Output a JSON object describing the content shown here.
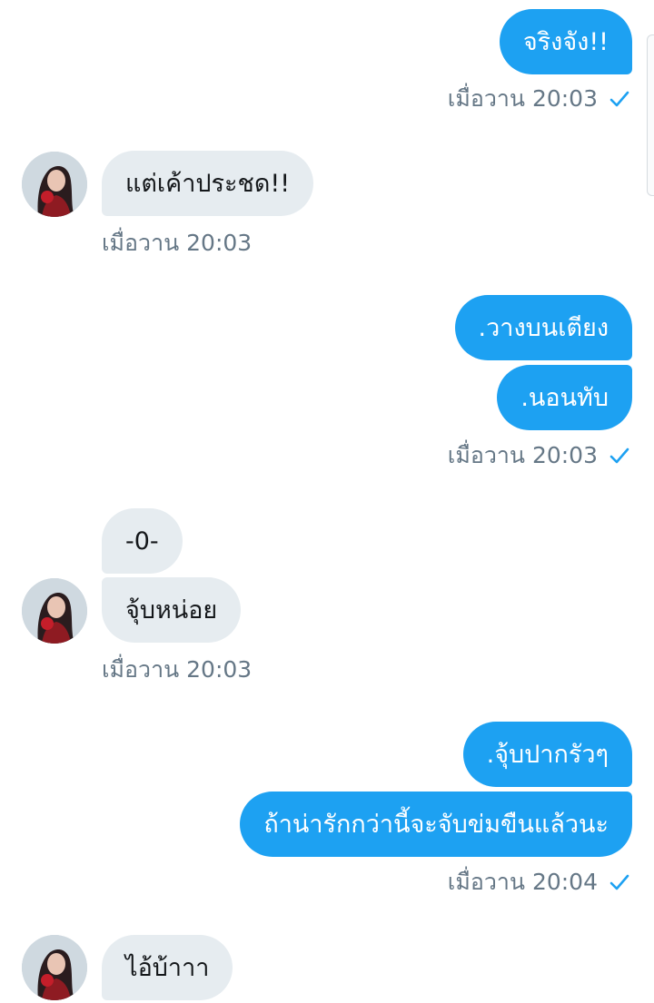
{
  "accent_color": "#1da1f2",
  "conversation": {
    "msg1": {
      "text": "จริงจัง!!",
      "time": "เมื่อวาน 20:03",
      "status_icon": "check-icon"
    },
    "msg2": {
      "text": "แต่เค้าประชด!!",
      "time": "เมื่อวาน 20:03"
    },
    "msg3": {
      "text": ".วางบนเตียง"
    },
    "msg4": {
      "text": ".นอนทับ",
      "time": "เมื่อวาน 20:03",
      "status_icon": "check-icon"
    },
    "msg5": {
      "text": "-0-"
    },
    "msg6": {
      "text": "จุ้บหน่อย",
      "time": "เมื่อวาน 20:03"
    },
    "msg7": {
      "text": ".จุ้บปากรัวๆ"
    },
    "msg8": {
      "text": "ถ้าน่ารักกว่านี้จะจับข่มขืนแล้วนะ",
      "time": "เมื่อวาน 20:04",
      "status_icon": "check-icon"
    },
    "msg9": {
      "text": "ไอ้บ้าาา"
    }
  }
}
